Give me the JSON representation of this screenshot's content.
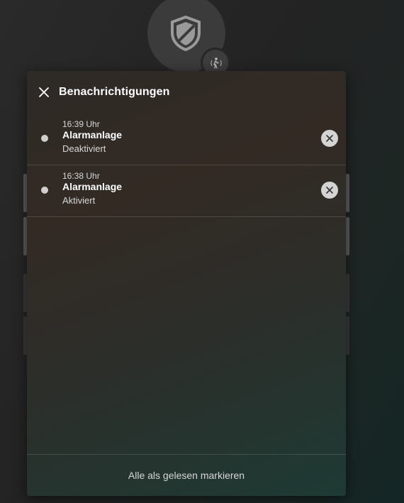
{
  "background": {
    "alarm_icon": "shield-icon",
    "motion_icon": "motion-sensor-icon"
  },
  "dialog": {
    "title": "Benachrichtigungen",
    "close_icon": "close-icon",
    "notifications": [
      {
        "time": "16:39 Uhr",
        "title": "Alarmanlage",
        "message": "Deaktiviert",
        "dismiss_icon": "close-icon"
      },
      {
        "time": "16:38 Uhr",
        "title": "Alarmanlage",
        "message": "Aktiviert",
        "dismiss_icon": "close-icon"
      }
    ],
    "footer": {
      "mark_all_label": "Alle als gelesen markieren"
    }
  },
  "colors": {
    "dot": "#cfcfcf",
    "dismiss_bg": "#d4d4d4",
    "text_primary": "#ffffff",
    "text_secondary": "#d8d8d8"
  }
}
